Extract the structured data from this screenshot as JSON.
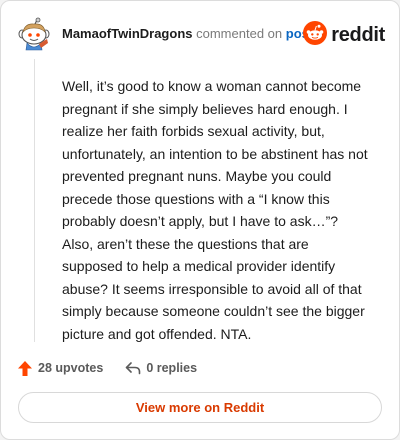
{
  "comment": {
    "author": "MamaofTwinDragons",
    "action_text": "commented on",
    "post_link": "post",
    "body": "Well, it’s good to know a woman cannot become pregnant if she simply believes hard enough. I realize her faith forbids sexual activity, but, unfortunately, an intention to be abstinent has not prevented pregnant nuns. Maybe you could precede those questions with a “I know this probably doesn’t apply, but I have to ask…”? Also, aren’t these the questions that are supposed to help a medical provider identify abuse? It seems irresponsible to avoid all of that simply because someone couldn’t see the bigger picture and got offended. NTA."
  },
  "brand": {
    "wordmark": "reddit",
    "icon": "reddit-logo-icon",
    "color": "#ff4500"
  },
  "stats": {
    "upvotes": "28 upvotes",
    "replies": "0 replies",
    "upvote_icon": "upvote-arrow-icon",
    "reply_icon": "reply-arrow-icon"
  },
  "footer": {
    "view_more_label": "View more on Reddit"
  },
  "colors": {
    "accent": "#d93a00",
    "upvote": "#ff4500",
    "link": "#0a66c2"
  }
}
